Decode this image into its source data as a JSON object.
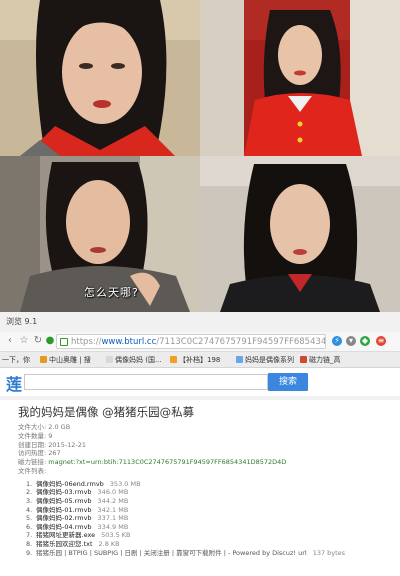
{
  "collage": {
    "subtitle": "怎么天哪?"
  },
  "browser": {
    "window_title": "浏览 9.1",
    "url": {
      "scheme": "https://",
      "host": "www.bturl.cc",
      "path": "/7113C0C2747675791F94597FF685434"
    },
    "tabs": [
      {
        "label": "一下，你"
      },
      {
        "label": "中山奥雕 | 搜"
      },
      {
        "label": "偶像妈妈 (国..."
      },
      {
        "label": "【补档】198"
      },
      {
        "label": "妈妈是偶像系列"
      },
      {
        "label": "磁力链_高"
      }
    ],
    "search": {
      "logo": "莲",
      "button_label": "搜索",
      "value": ""
    }
  },
  "torrent": {
    "title": "我的妈妈是偶像 @猪猪乐园@私募",
    "meta": [
      {
        "label": "文件大小:",
        "value": "2.0 GB"
      },
      {
        "label": "文件数量:",
        "value": "9"
      },
      {
        "label": "创建日期:",
        "value": "2015-12-21"
      },
      {
        "label": "访问热度:",
        "value": "267"
      }
    ],
    "magnet_label": "磁力链接:",
    "magnet": "magnet:?xt=urn:btih:7113C0C2747675791F94597FF6854341D8572D4D",
    "files_label": "文件列表:",
    "files": [
      {
        "num": "1.",
        "name": "偶像妈妈-06end.rmvb",
        "size": "353.0 MB"
      },
      {
        "num": "2.",
        "name": "偶像妈妈-03.rmvb",
        "size": "346.0 MB"
      },
      {
        "num": "3.",
        "name": "偶像妈妈-05.rmvb",
        "size": "344.2 MB"
      },
      {
        "num": "4.",
        "name": "偶像妈妈-01.rmvb",
        "size": "342.1 MB"
      },
      {
        "num": "5.",
        "name": "偶像妈妈-02.rmvb",
        "size": "337.1 MB"
      },
      {
        "num": "6.",
        "name": "偶像妈妈-04.rmvb",
        "size": "334.9 MB"
      },
      {
        "num": "7.",
        "name": "猪猪网址更新器.exe",
        "size": "503.5 KB"
      },
      {
        "num": "8.",
        "name": "猪猪乐园欢迎您.txt",
        "size": "2.8 KB"
      }
    ],
    "last_row": {
      "num": "9.",
      "name": "猪猪乐园 | BTPIG | SUBPIG | 日剧 | 关闭注册 | 靠窗可下载附件 | - Powered by Discuz! url",
      "size": "137 bytes"
    }
  },
  "colors": {
    "accent_blue": "#3b87e0",
    "link_blue": "#0a5dbf",
    "magnet_green": "#2b7a2b"
  }
}
